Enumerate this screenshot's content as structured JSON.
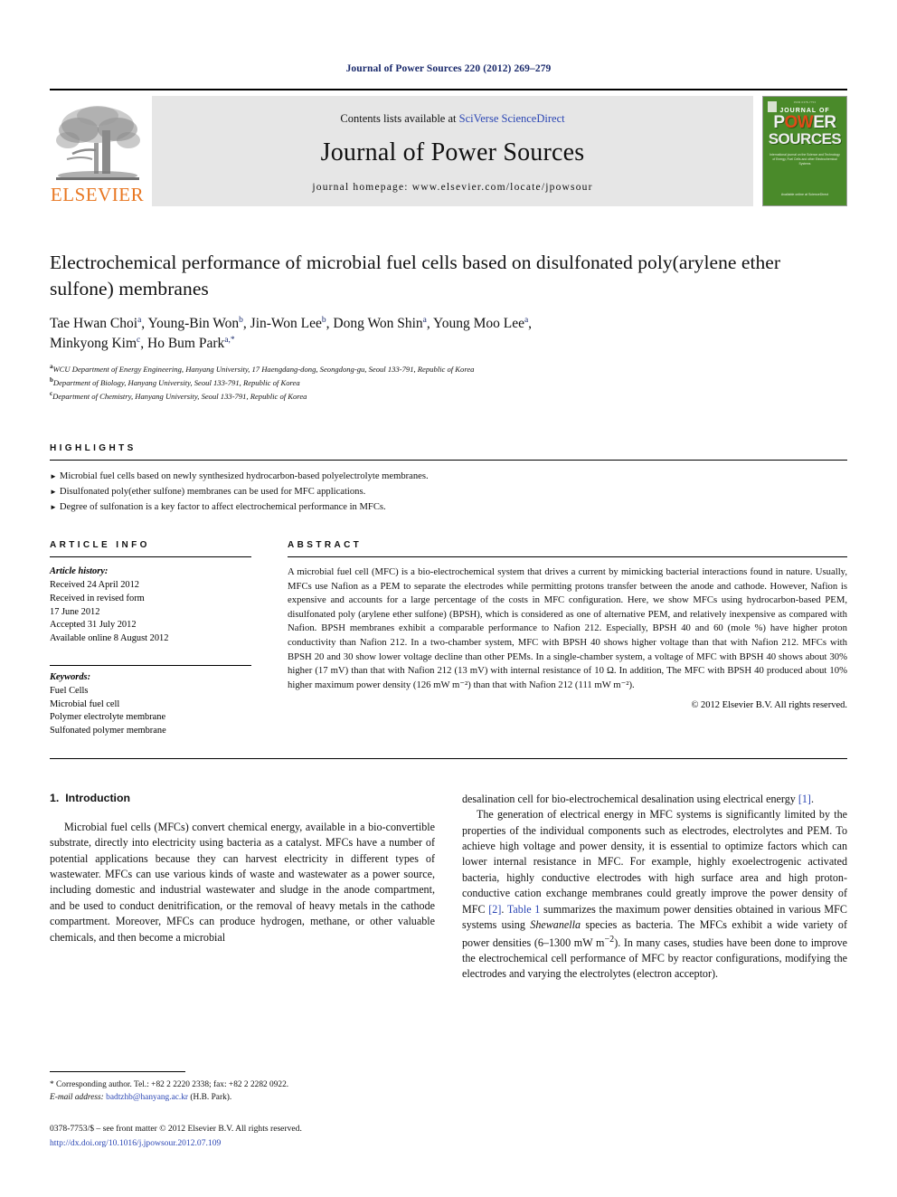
{
  "running_head": "Journal of Power Sources 220 (2012) 269–279",
  "masthead": {
    "publisher_name": "ELSEVIER",
    "contents_prefix": "Contents lists available at ",
    "contents_link": "SciVerse ScienceDirect",
    "journal_title": "Journal of Power Sources",
    "homepage": "journal homepage: www.elsevier.com/locate/jpowsour",
    "cover": {
      "issn": "ISSN 0378-7753",
      "line1": "JOURNAL OF",
      "line2_a": "P",
      "line2_b": "OW",
      "line2_c": "ER",
      "line3": "SOURCES",
      "subtitle": "International journal on the Science and Technology of Energy, Fuel Cells and other Electrochemical Systems",
      "footer": "Available online at\nScienceDirect"
    }
  },
  "article": {
    "title": "Electrochemical performance of microbial fuel cells based on disulfonated poly(arylene ether sulfone) membranes",
    "authors": [
      {
        "name": "Tae Hwan Choi",
        "sup": "a",
        "sep": ", "
      },
      {
        "name": "Young-Bin Won",
        "sup": "b",
        "sep": ", "
      },
      {
        "name": "Jin-Won Lee",
        "sup": "b",
        "sep": ", "
      },
      {
        "name": "Dong Won Shin",
        "sup": "a",
        "sep": ", "
      },
      {
        "name": "Young Moo Lee",
        "sup": "a",
        "sep": ","
      },
      {
        "name": "Minkyong Kim",
        "sup": "c",
        "sep": ", "
      },
      {
        "name": "Ho Bum Park",
        "sup": "a,*",
        "sep": ""
      }
    ],
    "affiliations": [
      {
        "mark": "a",
        "text": "WCU Department of Energy Engineering, Hanyang University, 17 Haengdang-dong, Seongdong-gu, Seoul 133-791, Republic of Korea"
      },
      {
        "mark": "b",
        "text": "Department of Biology, Hanyang University, Seoul 133-791, Republic of Korea"
      },
      {
        "mark": "c",
        "text": "Department of Chemistry, Hanyang University, Seoul 133-791, Republic of Korea"
      }
    ]
  },
  "highlights": {
    "label": "HIGHLIGHTS",
    "items": [
      "Microbial fuel cells based on newly synthesized hydrocarbon-based polyelectrolyte membranes.",
      "Disulfonated poly(ether sulfone) membranes can be used for MFC applications.",
      "Degree of sulfonation is a key factor to affect electrochemical performance in MFCs."
    ]
  },
  "article_info": {
    "label": "ARTICLE INFO",
    "history_head": "Article history:",
    "history": [
      "Received 24 April 2012",
      "Received in revised form",
      "17 June 2012",
      "Accepted 31 July 2012",
      "Available online 8 August 2012"
    ],
    "keywords_head": "Keywords:",
    "keywords": [
      "Fuel Cells",
      "Microbial fuel cell",
      "Polymer electrolyte membrane",
      "Sulfonated polymer membrane"
    ]
  },
  "abstract": {
    "label": "ABSTRACT",
    "text": "A microbial fuel cell (MFC) is a bio-electrochemical system that drives a current by mimicking bacterial interactions found in nature. Usually, MFCs use Nafion as a PEM to separate the electrodes while permitting protons transfer between the anode and cathode. However, Nafion is expensive and accounts for a large percentage of the costs in MFC configuration. Here, we show MFCs using hydrocarbon-based PEM, disulfonated poly (arylene ether sulfone) (BPSH), which is considered as one of alternative PEM, and relatively inexpensive as compared with Nafion. BPSH membranes exhibit a comparable performance to Nafion 212. Especially, BPSH 40 and 60 (mole %) have higher proton conductivity than Nafion 212. In a two-chamber system, MFC with BPSH 40 shows higher voltage than that with Nafion 212. MFCs with BPSH 20 and 30 show lower voltage decline than other PEMs. In a single-chamber system, a voltage of MFC with BPSH 40 shows about 30% higher (17 mV) than that with Nafion 212 (13 mV) with internal resistance of 10 Ω. In addition, The MFC with BPSH 40 produced about 10% higher maximum power density (126 mW m⁻²) than that with Nafion 212 (111 mW m⁻²).",
    "copyright": "© 2012 Elsevier B.V. All rights reserved."
  },
  "introduction": {
    "number": "1.",
    "heading": "Introduction",
    "left_paragraph_1": "Microbial fuel cells (MFCs) convert chemical energy, available in a bio-convertible substrate, directly into electricity using bacteria as a catalyst. MFCs have a number of potential applications because they can harvest electricity in different types of wastewater. MFCs can use various kinds of waste and wastewater as a power source, including domestic and industrial wastewater and sludge in the anode compartment, and be used to conduct denitrification, or the removal of heavy metals in the cathode compartment. Moreover, MFCs can produce hydrogen, methane, or other valuable chemicals, and then become a microbial",
    "right_paragraph_1_cont": "desalination cell for bio-electrochemical desalination using electrical energy [1].",
    "right_paragraph_2": "The generation of electrical energy in MFC systems is significantly limited by the properties of the individual components such as electrodes, electrolytes and PEM. To achieve high voltage and power density, it is essential to optimize factors which can lower internal resistance in MFC. For example, highly exoelectrogenic activated bacteria, highly conductive electrodes with high surface area and high proton-conductive cation exchange membranes could greatly improve the power density of MFC [2]. Table 1 summarizes the maximum power densities obtained in various MFC systems using Shewanella species as bacteria. The MFCs exhibit a wide variety of power densities (6–1300 mW m⁻²). In many cases, studies have been done to improve the electrochemical cell performance of MFC by reactor configurations, modifying the electrodes and varying the electrolytes (electron acceptor).",
    "ref_1": "[1]",
    "ref_2": "[2]",
    "table_ref": "Table 1"
  },
  "footnote": {
    "line1": "* Corresponding author. Tel.: +82 2 2220 2338; fax: +82 2 2282 0922.",
    "email_label": "E-mail address:",
    "email": "badtzhb@hanyang.ac.kr",
    "email_owner": "(H.B. Park)."
  },
  "colophon": {
    "line1": "0378-7753/$ – see front matter © 2012 Elsevier B.V. All rights reserved.",
    "doi": "http://dx.doi.org/10.1016/j.jpowsour.2012.07.109"
  },
  "colors": {
    "link": "#2b46b4",
    "running_head": "#1a2a6c",
    "elsevier_orange": "#E87722",
    "cover_green": "#4a8a2a",
    "banner_gray": "#e6e6e6"
  }
}
